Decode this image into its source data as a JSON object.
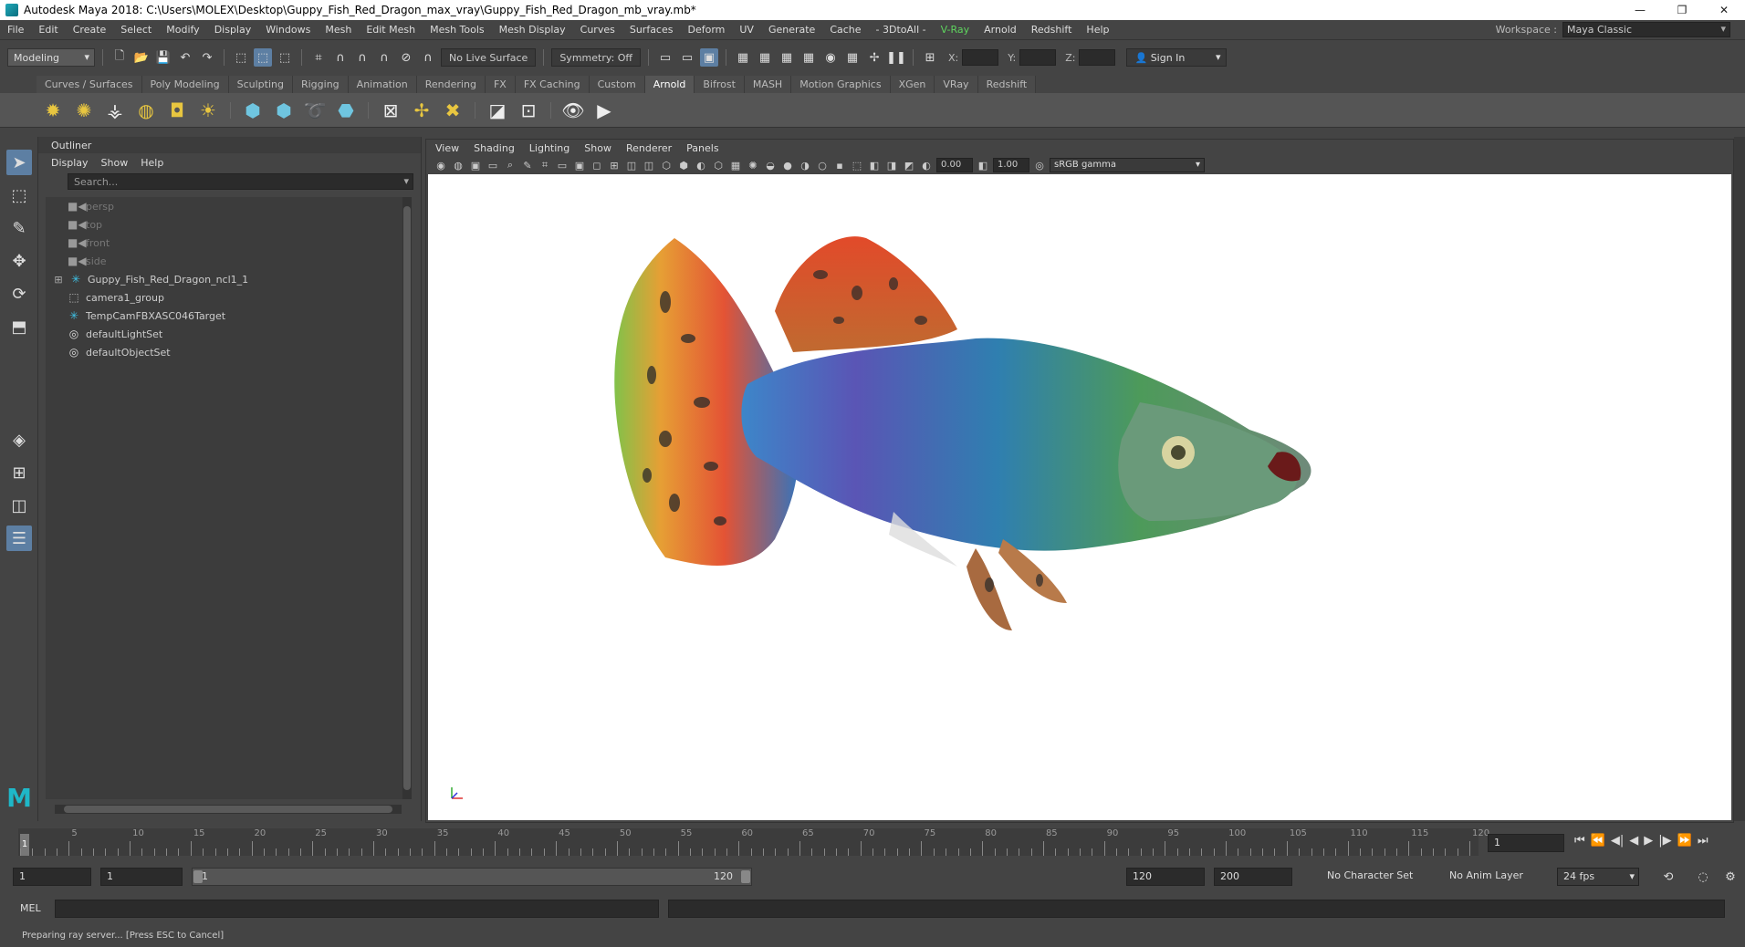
{
  "window": {
    "title": "Autodesk Maya 2018: C:\\Users\\MOLEX\\Desktop\\Guppy_Fish_Red_Dragon_max_vray\\Guppy_Fish_Red_Dragon_mb_vray.mb*",
    "minimize": "—",
    "restore": "❐",
    "close": "✕"
  },
  "menubar": {
    "items": [
      "File",
      "Edit",
      "Create",
      "Select",
      "Modify",
      "Display",
      "Windows",
      "Mesh",
      "Edit Mesh",
      "Mesh Tools",
      "Mesh Display",
      "Curves",
      "Surfaces",
      "Deform",
      "UV",
      "Generate",
      "Cache",
      "- 3DtoAll -",
      "V-Ray",
      "Arnold",
      "Redshift",
      "Help"
    ],
    "workspace_label": "Workspace :",
    "workspace_value": "Maya Classic"
  },
  "statusline": {
    "mode": "Modeling",
    "live_surface": "No Live Surface",
    "symmetry": "Symmetry: Off",
    "x_label": "X:",
    "y_label": "Y:",
    "z_label": "Z:",
    "sign_in": "Sign In"
  },
  "shelf": {
    "tabs": [
      "Curves / Surfaces",
      "Poly Modeling",
      "Sculpting",
      "Rigging",
      "Animation",
      "Rendering",
      "FX",
      "FX Caching",
      "Custom",
      "Arnold",
      "Bifrost",
      "MASH",
      "Motion Graphics",
      "XGen",
      "VRay",
      "Redshift"
    ],
    "active_tab": "Arnold"
  },
  "outliner": {
    "title": "Outliner",
    "menu": [
      "Display",
      "Show",
      "Help"
    ],
    "search_placeholder": "Search...",
    "items": [
      {
        "label": "persp",
        "icon": "camera-icon",
        "dim": true,
        "expandable": false
      },
      {
        "label": "top",
        "icon": "camera-icon",
        "dim": true,
        "expandable": false
      },
      {
        "label": "front",
        "icon": "camera-icon",
        "dim": true,
        "expandable": false
      },
      {
        "label": "side",
        "icon": "camera-icon",
        "dim": true,
        "expandable": false
      },
      {
        "label": "Guppy_Fish_Red_Dragon_ncl1_1",
        "icon": "transform-icon",
        "dim": false,
        "expandable": true
      },
      {
        "label": "camera1_group",
        "icon": "group-icon",
        "dim": false,
        "expandable": false
      },
      {
        "label": "TempCamFBXASC046Target",
        "icon": "transform-icon",
        "dim": false,
        "expandable": false
      },
      {
        "label": "defaultLightSet",
        "icon": "set-icon",
        "dim": false,
        "expandable": false
      },
      {
        "label": "defaultObjectSet",
        "icon": "set-icon",
        "dim": false,
        "expandable": false
      }
    ]
  },
  "viewport": {
    "menu": [
      "View",
      "Shading",
      "Lighting",
      "Show",
      "Renderer",
      "Panels"
    ],
    "exposure": "0.00",
    "gamma": "1.00",
    "color_space": "sRGB gamma"
  },
  "timeline": {
    "ticks": [
      "5",
      "10",
      "15",
      "20",
      "25",
      "30",
      "35",
      "40",
      "45",
      "50",
      "55",
      "60",
      "65",
      "70",
      "75",
      "80",
      "85",
      "90",
      "95",
      "100",
      "105",
      "110",
      "115",
      "120"
    ],
    "current_frame_marker": "1",
    "current_frame": "1"
  },
  "range": {
    "start": "1",
    "playback_start": "1",
    "slider_lo": "1",
    "slider_hi": "120",
    "playback_end": "120",
    "end": "200",
    "character_set": "No Character Set",
    "anim_layer": "No Anim Layer",
    "fps": "24 fps"
  },
  "command": {
    "label": "MEL"
  },
  "helpline": {
    "text": "Preparing ray server... [Press ESC to Cancel]"
  }
}
